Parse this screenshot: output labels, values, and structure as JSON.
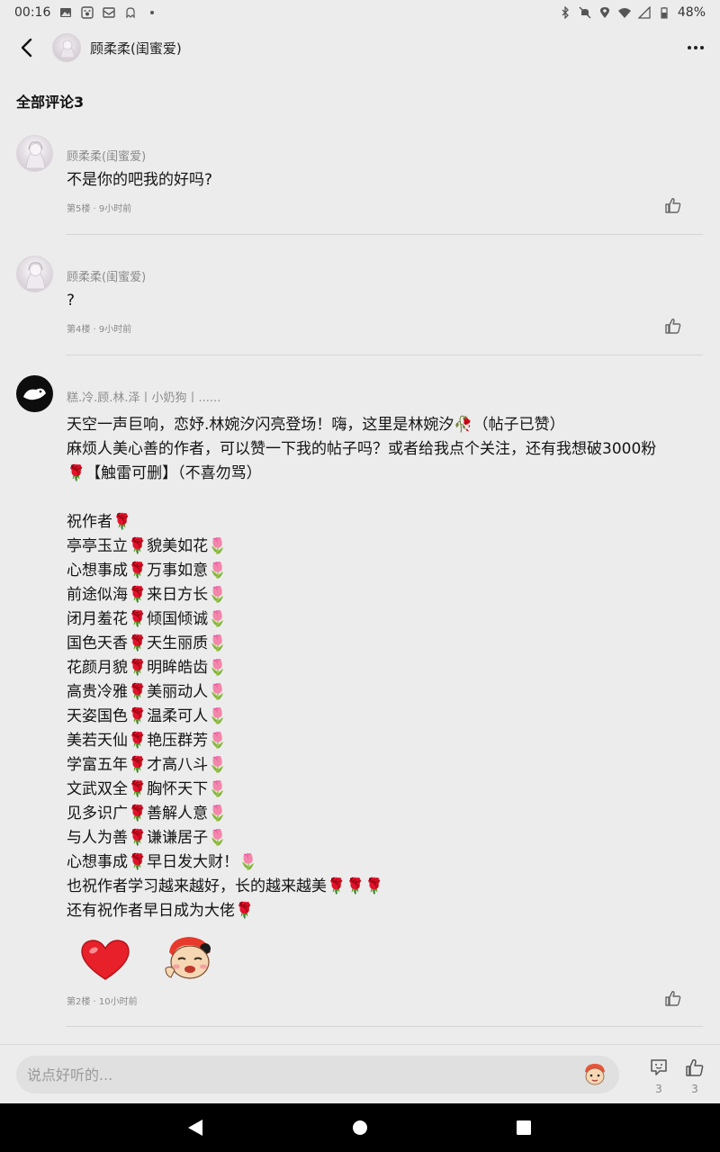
{
  "status_bar": {
    "time": "00:16",
    "battery": "48%",
    "icons": [
      "image-icon",
      "paw-icon",
      "mail-icon",
      "ghost-icon",
      "dot-icon",
      "bluetooth-icon",
      "bell-off-icon",
      "location-icon",
      "wifi-icon",
      "signal-icon",
      "battery-icon"
    ]
  },
  "header": {
    "title": "顾柔柔(闺蜜爱)"
  },
  "section": {
    "title": "全部评论3"
  },
  "comments": [
    {
      "author": "顾柔柔(闺蜜爱)",
      "lines": [
        "不是你的吧我的好吗?"
      ],
      "floor": "第5楼",
      "time": "9小时前"
    },
    {
      "author": "顾柔柔(闺蜜爱)",
      "lines": [
        "?"
      ],
      "floor": "第4楼",
      "time": "9小时前"
    },
    {
      "author": "糕.冷.顾.林.泽丨小奶狗丨......",
      "lines": [
        "天空一声巨响，恋妤.林婉汐闪亮登场！嗨，这里是林婉汐🥀（帖子已赞）",
        "麻烦人美心善的作者，可以赞一下我的帖子吗？或者给我点个关注，还有我想破3000粉",
        "🌹【触雷可删】（不喜勿骂）",
        "",
        "祝作者🌹",
        "亭亭玉立🌹貌美如花🌷",
        "心想事成🌹万事如意🌷",
        "前途似海🌹来日方长🌷",
        "闭月羞花🌹倾国倾诚🌷",
        "国色天香🌹天生丽质🌷",
        "花颜月貌🌹明眸皓齿🌷",
        "高贵冷雅🌹美丽动人🌷",
        "天姿国色🌹温柔可人🌷",
        "美若天仙🌹艳压群芳🌷",
        "学富五年🌹才高八斗🌷",
        "文武双全🌹胸怀天下🌷",
        "见多识广🌹善解人意🌷",
        "与人为善🌹谦谦居子🌷",
        "心想事成🌹早日发大财！🌷",
        "也祝作者学习越来越好，长的越来越美🌹🌹🌹",
        "还有祝作者早日成为大佬🌹"
      ],
      "stickers": [
        "heart-sticker",
        "cartoon-boy-sticker"
      ],
      "floor": "第2楼",
      "time": "10小时前"
    }
  ],
  "bottom_bar": {
    "input_placeholder": "说点好听的...",
    "comment_count": "3",
    "like_count": "3"
  },
  "colors": {
    "background": "#ececec",
    "divider": "#d6d6d6",
    "heart": "#e8202a"
  }
}
